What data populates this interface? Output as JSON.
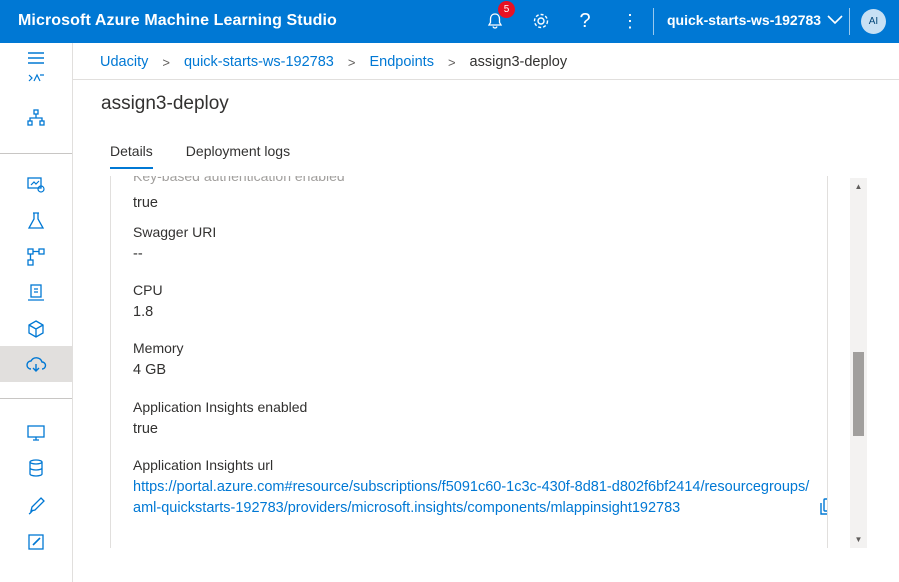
{
  "app": {
    "title": "Microsoft Azure Machine Learning Studio",
    "notification_count": "5",
    "workspace": "quick-starts-ws-192783",
    "avatar_initials": "AI",
    "accent_color": "#0078d4"
  },
  "breadcrumb": {
    "items": [
      "Udacity",
      "quick-starts-ws-192783",
      "Endpoints"
    ],
    "current": "assign3-deploy"
  },
  "page": {
    "title": "assign3-deploy",
    "tabs": [
      {
        "label": "Details",
        "selected": true
      },
      {
        "label": "Deployment logs",
        "selected": false
      }
    ]
  },
  "details": {
    "clipped_label": "Key-based authentication enabled",
    "fields": [
      {
        "label": "",
        "value": "true"
      },
      {
        "label": "Swagger URI",
        "value": "--"
      },
      {
        "label": "CPU",
        "value": "1.8"
      },
      {
        "label": "Memory",
        "value": "4 GB"
      },
      {
        "label": "Application Insights enabled",
        "value": "true"
      },
      {
        "label": "Application Insights url",
        "value": "https://portal.azure.com#resource/subscriptions/f5091c60-1c3c-430f-8d81-d802f6bf2414/resourcegroups/aml-quickstarts-192783/providers/microsoft.insights/components/mlappinsight192783"
      }
    ]
  },
  "sidebar": {
    "icons": [
      "menu-icon",
      "automl-icon",
      "designer-icon",
      "datasets-icon",
      "experiments-icon",
      "pipelines-icon",
      "jobs-icon",
      "models-icon",
      "endpoints-icon",
      "compute-icon",
      "datastores-icon",
      "labeling-icon",
      "notebook-icon"
    ]
  }
}
